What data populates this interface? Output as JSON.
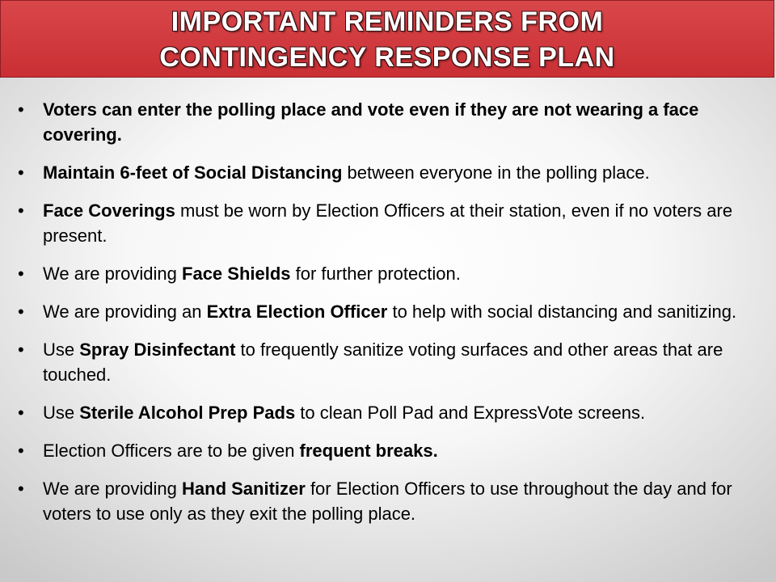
{
  "title": {
    "line1": "IMPORTANT REMINDERS FROM",
    "line2": "CONTINGENCY RESPONSE PLAN"
  },
  "bullet_symbol": "•",
  "bullets": [
    {
      "bold": "Voters can enter the polling place and vote even if they are not wearing a face covering."
    },
    {
      "bold": "Maintain 6-feet of Social Distancing",
      "after": " between everyone in the polling place."
    },
    {
      "bold": "Face Coverings",
      "after": " must be worn by Election Officers at their station, even if no voters are present."
    },
    {
      "before": "We are providing ",
      "bold": "Face Shields",
      "after": " for further protection."
    },
    {
      "before": "We are providing an ",
      "bold": "Extra Election Officer",
      "after": " to help with social distancing and sanitizing."
    },
    {
      "before": "Use ",
      "bold": "Spray Disinfectant",
      "after": " to frequently sanitize voting surfaces and other areas that are touched."
    },
    {
      "before": "Use ",
      "bold": "Sterile Alcohol Prep Pads",
      "after": " to clean Poll Pad and ExpressVote screens."
    },
    {
      "before": "Election Officers are to be given ",
      "bold": "frequent breaks."
    },
    {
      "before": "We are providing ",
      "bold": "Hand Sanitizer",
      "after": " for Election Officers to use throughout the day and for voters to use only as they exit the polling place."
    }
  ]
}
